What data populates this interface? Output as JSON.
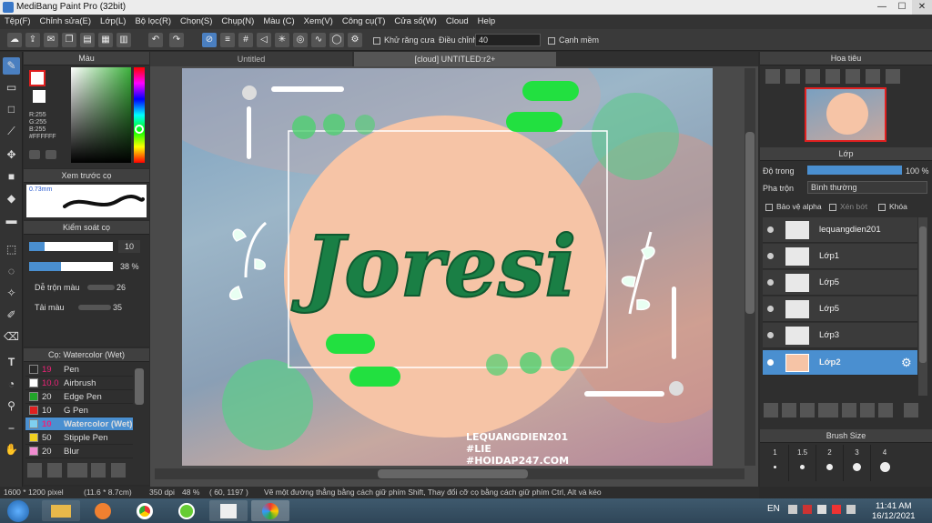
{
  "window": {
    "title": "MediBang Paint Pro (32bit)",
    "min": "—",
    "max": "☐",
    "close": "✕"
  },
  "menu": [
    "Tệp(F)",
    "Chỉnh sửa(E)",
    "Lớp(L)",
    "Bộ lọc(R)",
    "Chọn(S)",
    "Chụp(N)",
    "Màu (C)",
    "Xem(V)",
    "Công cụ(T)",
    "Cửa sổ(W)",
    "Cloud",
    "Help"
  ],
  "toolbar": {
    "antialias_label": "Khử răng cưa",
    "adjust_label": "Điều chỉnh",
    "adjust_value": "40",
    "edge_label": "Cạnh mềm"
  },
  "color_panel": {
    "title": "Màu",
    "r": "R:255",
    "g": "G:255",
    "b": "B:255",
    "hex": "#FFFFFF"
  },
  "preview_panel": {
    "title": "Xem trước cọ",
    "size": "0.73mm"
  },
  "brush_control": {
    "title": "Kiểm soát cọ",
    "size": "10",
    "opacity": "38 %",
    "mix_label": "Dễ trộn màu",
    "mix_value": "26",
    "load_label": "Tải màu",
    "load_value": "35"
  },
  "brush_list": {
    "title": "Cọ: Watercolor (Wet)",
    "items": [
      {
        "size": "19",
        "name": "Pen",
        "color": "#2a2a2a"
      },
      {
        "size": "10.0",
        "name": "Airbrush",
        "color": "#ffffff"
      },
      {
        "size": "20",
        "name": "Edge Pen",
        "color": "#22a52a"
      },
      {
        "size": "10",
        "name": "G Pen",
        "color": "#e02020"
      },
      {
        "size": "10",
        "name": "Watercolor (Wet)",
        "color": "#7fd0f0"
      },
      {
        "size": "50",
        "name": "Stipple Pen",
        "color": "#f0d020"
      },
      {
        "size": "20",
        "name": "Blur",
        "color": "#f08cd0"
      }
    ]
  },
  "tabs": [
    "Untitled",
    "[cloud] UNTITLED:r2+"
  ],
  "artwork": {
    "word": "Joresi",
    "credit1": "LEQUANGDIEN201",
    "credit2": "#LIE",
    "credit3": "#HOIDAP247.COM"
  },
  "navigator": {
    "title": "Hoa tiêu"
  },
  "layer_panel": {
    "title": "Lớp",
    "opacity_label": "Độ trong",
    "opacity_value": "100 %",
    "blend_label": "Pha trộn",
    "blend_value": "Bình thường",
    "protect_alpha": "Bảo vệ alpha",
    "clip": "Xén bớt",
    "lock": "Khóa",
    "layers": [
      "lequangdien201",
      "Lớp1",
      "Lớp5",
      "Lớp5",
      "Lớp3",
      "Lớp2"
    ]
  },
  "brush_size": {
    "title": "Brush Size",
    "sizes": [
      "1",
      "1.5",
      "2",
      "3",
      "4"
    ]
  },
  "status": {
    "dims": "1600 * 1200 pixel",
    "phys": "(11.6 * 8.7cm)",
    "dpi": "350 dpi",
    "zoom": "48 %",
    "coords": "( 60, 1197 )",
    "hint": "Vẽ một đường thẳng bằng cách giữ phím Shift, Thay đổi cỡ cọ bằng cách giữ phím Ctrl, Alt và kéo"
  },
  "taskbar": {
    "lang": "EN",
    "time": "11:41 AM",
    "date": "16/12/2021"
  },
  "colors": {
    "accent": "#4a8fd0",
    "peach": "#f6c4a6",
    "green": "#1f8a4c"
  }
}
